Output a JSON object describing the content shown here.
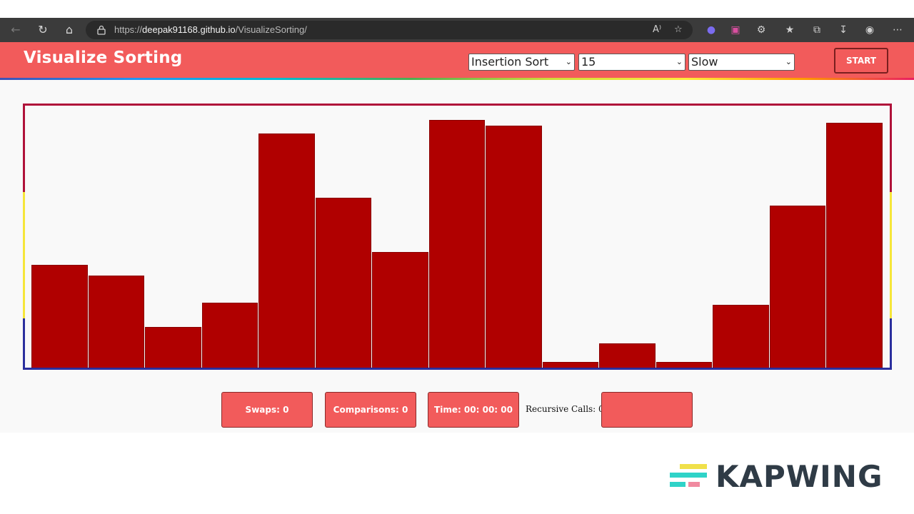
{
  "browser": {
    "url_prefix": "https://",
    "url_host": "deepak91168.github.io",
    "url_path": "/VisualizeSorting/",
    "read_aloud_label": "A⁾"
  },
  "header": {
    "title": "Visualize Sorting",
    "algorithm_selected": "Insertion Sort",
    "size_selected": "15",
    "speed_selected": "Slow",
    "start_label": "START",
    "colors": {
      "header_bg": "#f25b5b",
      "bar": "#b00000"
    }
  },
  "stats": {
    "swaps_label": "Swaps: 0",
    "comparisons_label": "Comparisons: 0",
    "time_label": "Time: 00: 00: 00",
    "recursive_calls_label": "Recursive Calls: 0",
    "extra_button_label": ""
  },
  "chart_data": {
    "type": "bar",
    "values": [
      144,
      129,
      57,
      91,
      328,
      238,
      162,
      347,
      339,
      8,
      34,
      8,
      88,
      227,
      343
    ],
    "ylim": [
      0,
      360
    ]
  },
  "watermark": {
    "text": "KAPWING"
  }
}
